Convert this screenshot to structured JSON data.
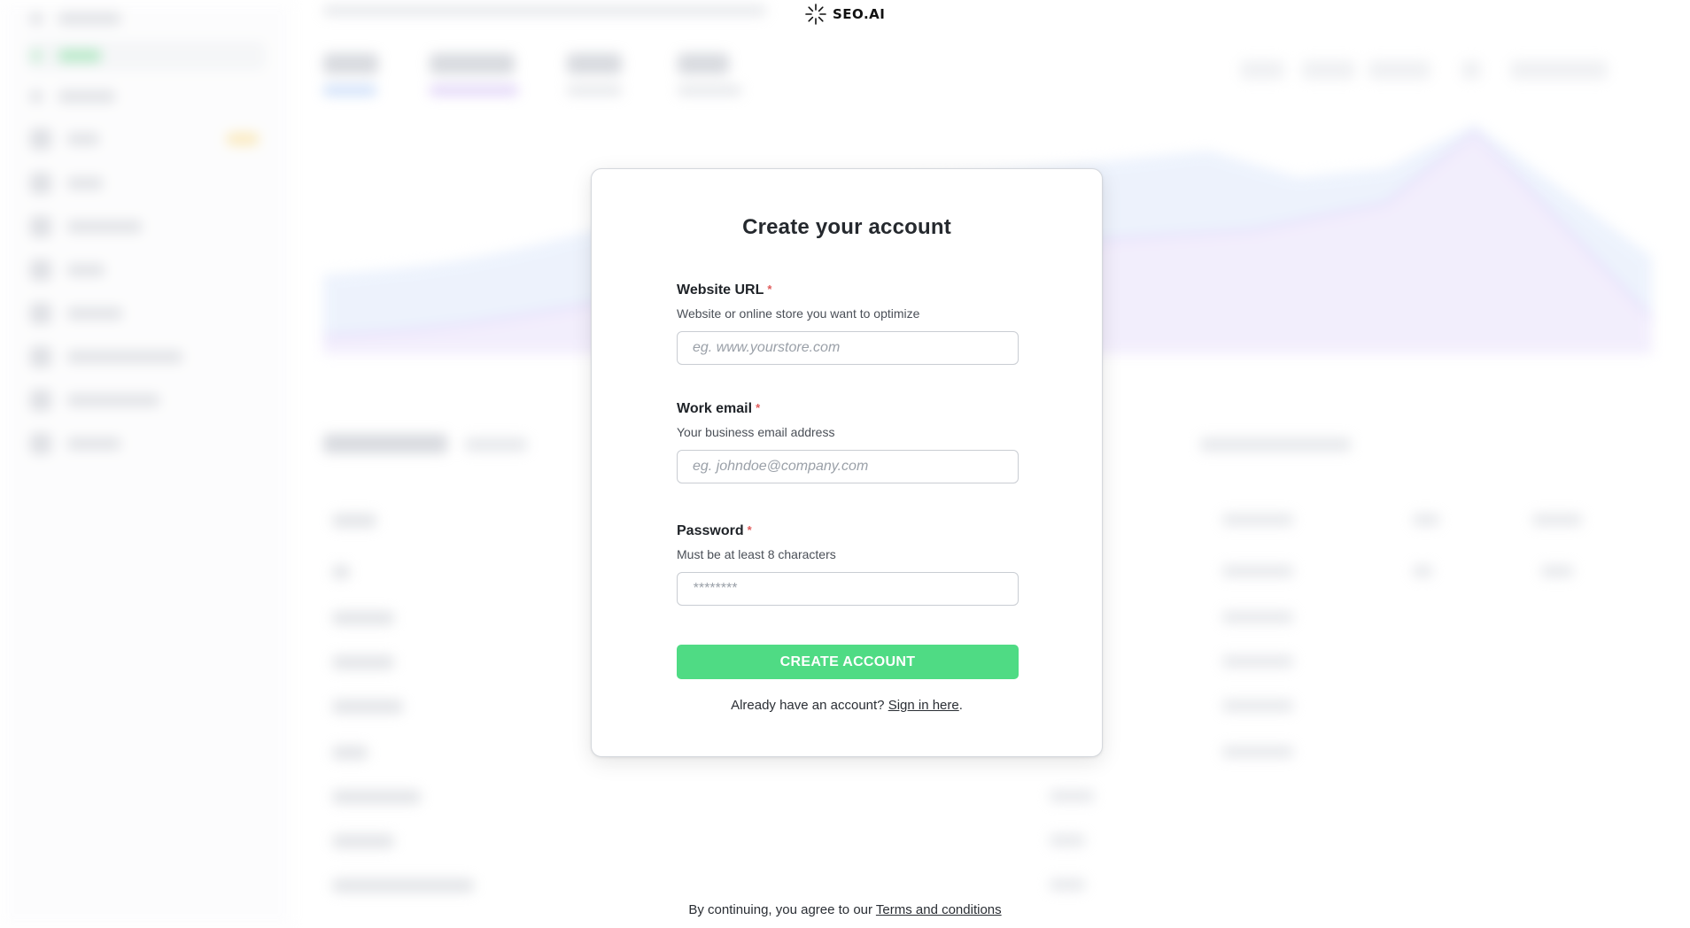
{
  "brand": {
    "name": "SEO.AI"
  },
  "form": {
    "title": "Create your account",
    "fields": [
      {
        "label": "Website URL",
        "required_mark": "*",
        "help": "Website or online store you want to optimize",
        "placeholder": "eg. www.yourstore.com",
        "value": ""
      },
      {
        "label": "Work email",
        "required_mark": "*",
        "help": "Your business email address",
        "placeholder": "eg. johndoe@company.com",
        "value": ""
      },
      {
        "label": "Password",
        "required_mark": "*",
        "help": "Must be at least 8 characters",
        "placeholder": "********",
        "value": ""
      }
    ],
    "submit_label": "CREATE ACCOUNT",
    "signin_prefix": "Already have an account? ",
    "signin_link": "Sign in here",
    "signin_suffix": "."
  },
  "footer": {
    "terms_prefix": "By continuing, you agree to our ",
    "terms_link": "Terms and conditions"
  },
  "colors": {
    "accent_green": "#4fdb84",
    "required_red": "#e05a5a"
  }
}
